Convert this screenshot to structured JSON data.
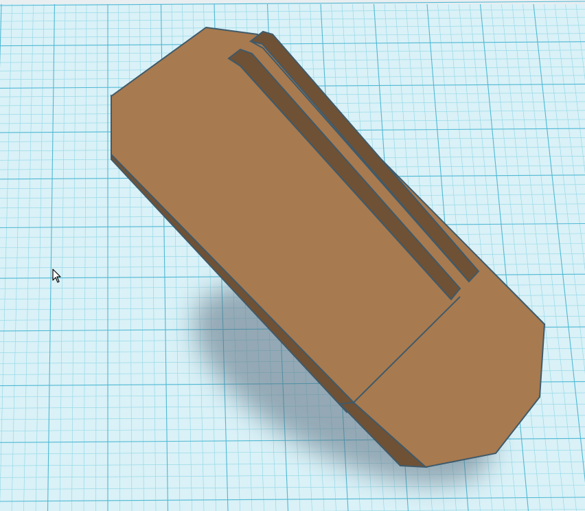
{
  "scene": {
    "object_name": "",
    "workplane": {
      "background_color": "#d9f1f7",
      "minor_grid_color": "#8fd6e6",
      "major_grid_color": "#4fb8d3"
    },
    "shape": {
      "top_face_color": "#a87a4f",
      "side_face_color": "#6f5135",
      "outline_color": "#3f5a6a",
      "shadow_color": "#5b6f80"
    }
  },
  "cursor": {
    "type": "arrow-pointer",
    "fill_color": "#ffffff",
    "stroke_color": "#000000"
  }
}
